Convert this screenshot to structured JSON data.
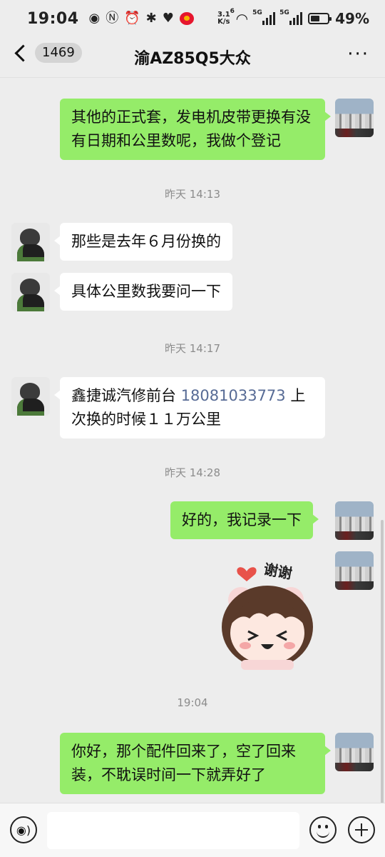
{
  "status_bar": {
    "time": "19:04",
    "net_speed_value": "3.1",
    "net_speed_unit": "K/s",
    "battery_percent": "49%",
    "signal_tag_1": "5G",
    "signal_tag_2": "5G",
    "wifi_tag": "6"
  },
  "header": {
    "unread_count": "1469",
    "title": "渝AZ85Q5大众",
    "more_label": "···"
  },
  "messages": [
    {
      "sender": "self",
      "text": "其他的正式套，发电机皮带更换有没有日期和公里数呢，我做个登记"
    },
    {
      "type": "time",
      "text": "昨天 14:13"
    },
    {
      "sender": "other",
      "text": "那些是去年６月份换的"
    },
    {
      "sender": "other",
      "text": "具体公里数我要问一下"
    },
    {
      "type": "time",
      "text": "昨天 14:17"
    },
    {
      "sender": "other",
      "text_before": "鑫捷诚汽修前台 ",
      "phone": "18081033773",
      "text_after": " 上次换的时候１１万公里"
    },
    {
      "type": "time",
      "text": "昨天 14:28"
    },
    {
      "sender": "self",
      "text": "好的，我记录一下"
    },
    {
      "sender": "self",
      "type": "sticker",
      "sticker_text": "谢谢"
    },
    {
      "type": "time",
      "text": "19:04"
    },
    {
      "sender": "self",
      "text": "你好，那个配件回来了，空了回来装，不耽误时间一下就弄好了"
    }
  ],
  "colors": {
    "outgoing_bubble": "#95ec69",
    "incoming_bubble": "#ffffff",
    "background": "#ededed",
    "link": "#576b95"
  },
  "icons": {
    "back": "chevron-left-icon",
    "more": "more-dots-icon",
    "voice": "voice-icon",
    "emoji": "emoji-icon",
    "plus": "plus-icon"
  }
}
